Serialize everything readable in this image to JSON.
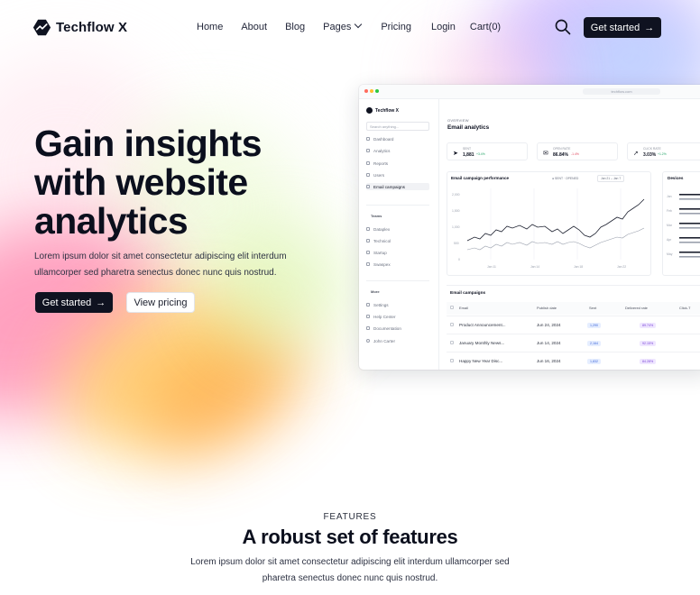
{
  "brand": {
    "name": "Techflow X",
    "logo_icon": "trend-line-logo-icon"
  },
  "nav": {
    "links": {
      "home": "Home",
      "about": "About",
      "blog": "Blog",
      "pages": "Pages",
      "pricing": "Pricing",
      "login": "Login",
      "cart": "Cart(0)"
    },
    "cta": "Get started"
  },
  "hero": {
    "title": "Gain insights with website analytics",
    "subtitle": "Lorem ipsum dolor sit amet consectetur adipiscing elit interdum ullamcorper sed pharetra senectus donec nunc quis nostrud.",
    "primary_cta": "Get started",
    "secondary_cta": "View pricing"
  },
  "mockup": {
    "url": "techflow.com",
    "brand": "Techflow X",
    "search_placeholder": "Search anything...",
    "nav": [
      "Dashboard",
      "Analytics",
      "Reports",
      "Users",
      "Email campaigns"
    ],
    "teams_label": "Teams",
    "teams": [
      "Dataplex",
      "Technicol",
      "Startup",
      "Swaspex"
    ],
    "more_label": "More",
    "more": [
      "Settings",
      "Help Center",
      "Documentation",
      "John Carter"
    ],
    "overview_label": "OVERVIEW",
    "page_title": "Email analytics",
    "stats": [
      {
        "label": "SENT",
        "value": "1,881",
        "change": "+3.4%"
      },
      {
        "label": "OPEN RATE",
        "value": "86.84%",
        "change": "-1.4%"
      },
      {
        "label": "CLICK RATE",
        "value": "3.03%",
        "change": "+1.2%"
      }
    ],
    "chart_title": "Email campaign performance",
    "legend": {
      "sent": "SENT",
      "opened": "OPENED"
    },
    "date_range": "Jan 21 – Jan 7",
    "x_ticks": [
      "Jan 11",
      "Jan 14",
      "Jan 18",
      "Jan 22"
    ],
    "y_ticks": [
      "2,000",
      "1,500",
      "1,000",
      "500",
      "0"
    ],
    "devices_title": "Devices",
    "devices_labels": [
      "Jan",
      "Feb",
      "Mar",
      "Apr",
      "May"
    ],
    "table_title": "Email campaigns",
    "table_headers": [
      "Email",
      "Publish date",
      "Sent",
      "Delivered rate",
      "Click-T"
    ],
    "rows": [
      {
        "email": "Product Announcement...",
        "date": "Jun 24, 2024",
        "sent": "1,290",
        "rate": "89.74%"
      },
      {
        "email": "January Monthly News...",
        "date": "Jun 14, 2024",
        "sent": "2,164",
        "rate": "92.15%"
      },
      {
        "email": "Happy New Year Disc...",
        "date": "Jun 16, 2024",
        "sent": "1,832",
        "rate": "84.28%"
      }
    ]
  },
  "features": {
    "kicker": "FEATURES",
    "title": "A robust set of features",
    "subtitle": "Lorem ipsum dolor sit amet consectetur adipiscing elit interdum ullamcorper sed pharetra senectus donec nunc quis nostrud."
  }
}
